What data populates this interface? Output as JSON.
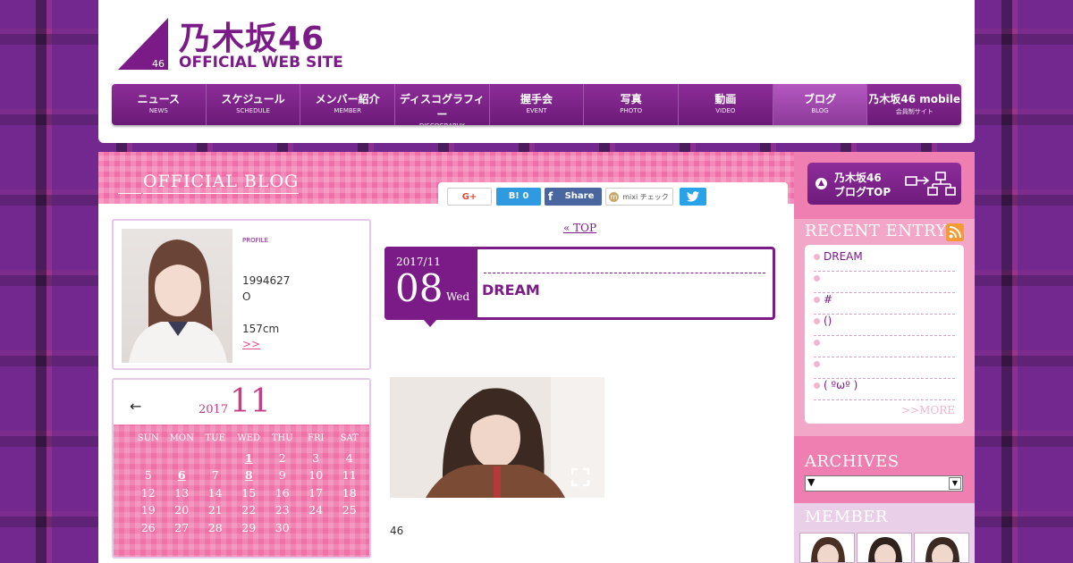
{
  "header": {
    "logo_jp": "乃木坂46",
    "logo_sub": "OFFICIAL WEB SITE",
    "logo_num": "46"
  },
  "nav": [
    {
      "jp": "ニュース",
      "en": "NEWS"
    },
    {
      "jp": "スケジュール",
      "en": "SCHEDULE"
    },
    {
      "jp": "メンバー紹介",
      "en": "MEMBER"
    },
    {
      "jp": "ディスコグラフィー",
      "en": "DISCOGRAPHY"
    },
    {
      "jp": "握手会",
      "en": "EVENT"
    },
    {
      "jp": "写真",
      "en": "PHOTO"
    },
    {
      "jp": "動画",
      "en": "VIDEO"
    },
    {
      "jp": "ブログ",
      "en": "BLOG"
    },
    {
      "jp": "乃木坂46 mobile",
      "en": "会員制サイト"
    }
  ],
  "blog": {
    "banner_title": "OFFICIAL BLOG",
    "top_link": "« TOP"
  },
  "share": {
    "gplus": "G+",
    "hatena": "B! 0",
    "facebook": "Share",
    "mixi": "mixi チェック"
  },
  "profile": {
    "label": "PROFILE",
    "birthday": "1994627",
    "blood": "O",
    "height": "157cm",
    "more": ">>"
  },
  "calendar": {
    "prev": "←",
    "year": "2017",
    "month": "11",
    "weekdays": [
      "SUN",
      "MON",
      "TUE",
      "WED",
      "THU",
      "FRI",
      "SAT"
    ],
    "weeks": [
      [
        "",
        "",
        "",
        "1",
        "2",
        "3",
        "4"
      ],
      [
        "5",
        "6",
        "7",
        "8",
        "9",
        "10",
        "11"
      ],
      [
        "12",
        "13",
        "14",
        "15",
        "16",
        "17",
        "18"
      ],
      [
        "19",
        "20",
        "21",
        "22",
        "23",
        "24",
        "25"
      ],
      [
        "26",
        "27",
        "28",
        "29",
        "30",
        "",
        ""
      ]
    ],
    "linked_days": [
      "1",
      "6",
      "8"
    ]
  },
  "entry": {
    "year_month": "2017/11",
    "day": "08",
    "weekday": "Wed",
    "title": "DREAM",
    "body": "46"
  },
  "sidebar": {
    "blogtop_line1": "乃木坂46",
    "blogtop_line2": "ブログTOP",
    "recent_title": "RECENT ENTRY",
    "recent_items": [
      "DREAM",
      "",
      "#",
      "()",
      "",
      "",
      "( ºωº )"
    ],
    "recent_more": ">>MORE",
    "archives_title": "ARCHIVES",
    "archives_selected": "▼",
    "member_title": "MEMBER"
  },
  "colors": {
    "brand_purple": "#7b1b87",
    "pink": "#ee7fb0",
    "light_pink": "#f2a7c8"
  }
}
